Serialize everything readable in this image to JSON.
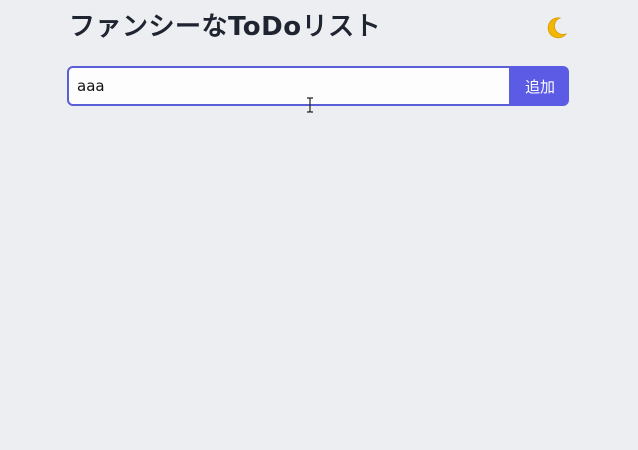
{
  "header": {
    "title": "ファンシーなToDoリスト",
    "theme_toggle_icon": "moon-icon"
  },
  "input": {
    "value": "aaa",
    "add_label": "追加"
  },
  "colors": {
    "background": "#edeef2",
    "accent": "#5b5be6",
    "input_border": "#5a5fd6",
    "title": "#1e2430",
    "moon": "#f2b705"
  },
  "todos": []
}
